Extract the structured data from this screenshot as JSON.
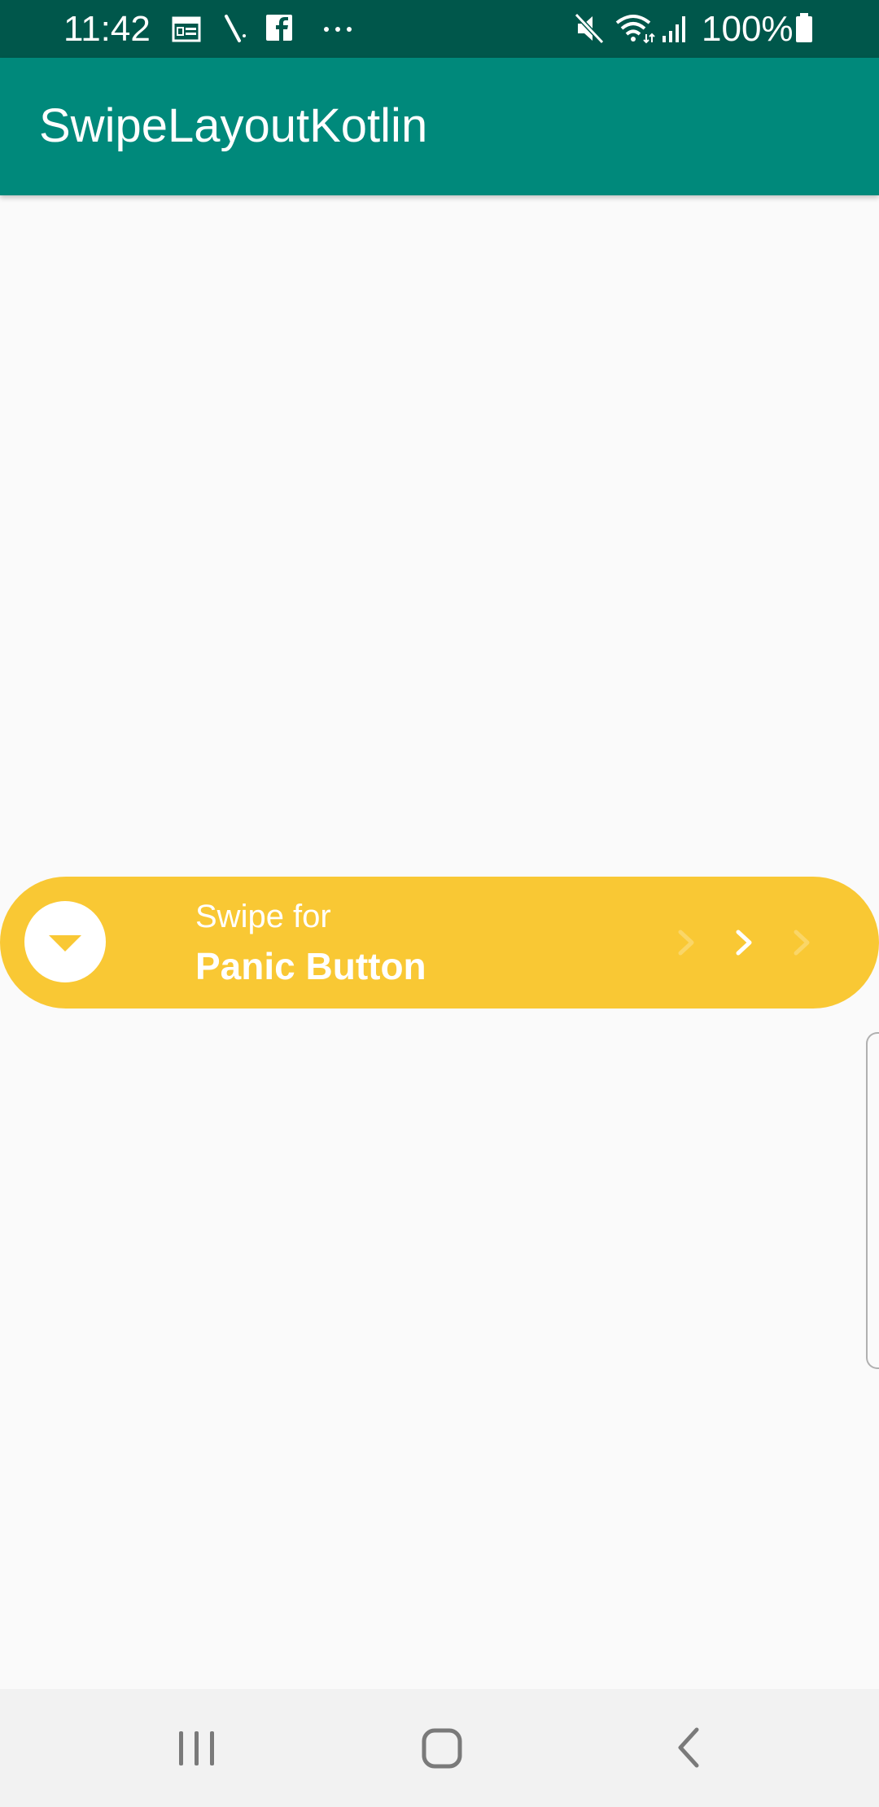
{
  "status_bar": {
    "time": "11:42",
    "battery_percent": "100%",
    "icons": [
      "calendar-icon",
      "stylus-icon",
      "facebook-icon",
      "more-notifications-icon",
      "mute-icon",
      "wifi-icon",
      "signal-icon",
      "battery-icon"
    ],
    "background_color": "#00574b"
  },
  "app_bar": {
    "title": "SwipeLayoutKotlin",
    "background_color": "#00897b"
  },
  "swipe_button": {
    "subtitle": "Swipe for",
    "title": "Panic Button",
    "knob_icon": "caret-down-icon",
    "arrow_icons": [
      "chevron-right-icon",
      "chevron-right-icon",
      "chevron-right-icon"
    ],
    "background_color": "#f9c834"
  },
  "nav_bar": {
    "buttons": [
      "recent-apps-icon",
      "home-icon",
      "back-icon"
    ],
    "background_color": "#f2f2f2"
  }
}
